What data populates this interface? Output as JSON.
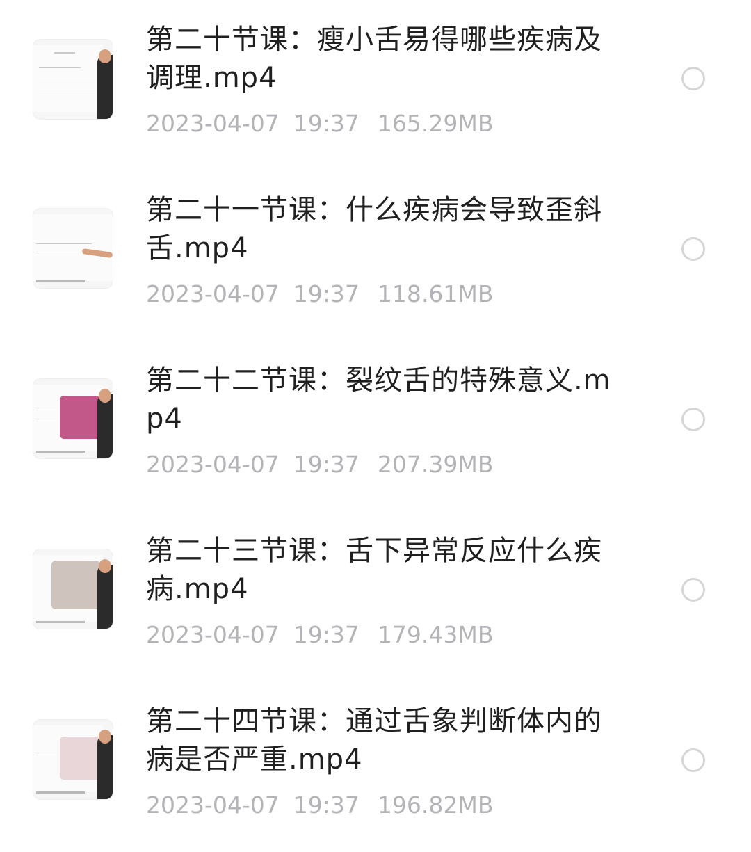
{
  "files": [
    {
      "title": "第二十节课：瘦小舌易得哪些疾病及调理.mp4",
      "date": "2023-04-07",
      "time": "19:37",
      "size": "165.29MB",
      "thumbnail": "video-thumbnail-icon",
      "selected": false
    },
    {
      "title": "第二十一节课：什么疾病会导致歪斜舌.mp4",
      "date": "2023-04-07",
      "time": "19:37",
      "size": "118.61MB",
      "thumbnail": "video-thumbnail-icon",
      "selected": false
    },
    {
      "title": "第二十二节课：裂纹舌的特殊意义.mp4",
      "date": "2023-04-07",
      "time": "19:37",
      "size": "207.39MB",
      "thumbnail": "video-thumbnail-icon",
      "selected": false
    },
    {
      "title": "第二十三节课：舌下异常反应什么疾病.mp4",
      "date": "2023-04-07",
      "time": "19:37",
      "size": "179.43MB",
      "thumbnail": "video-thumbnail-icon",
      "selected": false
    },
    {
      "title": "第二十四节课：通过舌象判断体内的病是否严重.mp4",
      "date": "2023-04-07",
      "time": "19:37",
      "size": "196.82MB",
      "thumbnail": "video-thumbnail-icon",
      "selected": false
    }
  ],
  "colors": {
    "title": "#202020",
    "meta": "#b3b3b8",
    "radio_border": "#d6d6d6",
    "background": "#ffffff"
  }
}
